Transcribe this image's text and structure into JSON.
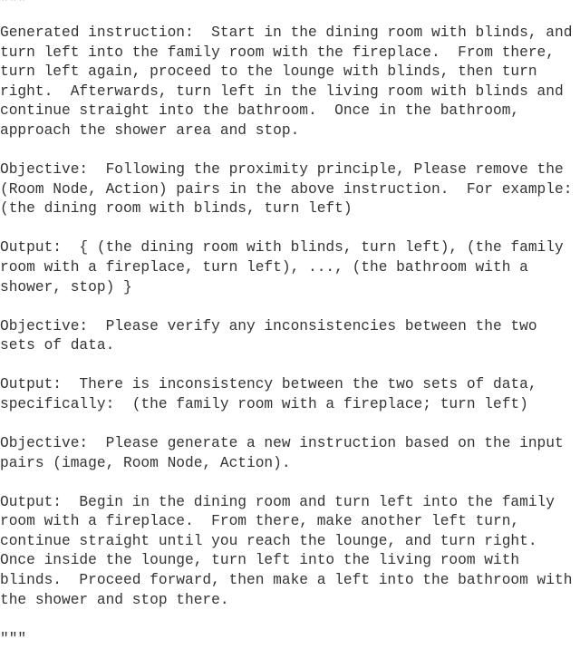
{
  "document": {
    "quote_open": "\"\"\"",
    "quote_close": "\"\"\"",
    "blocks": [
      {
        "role": "generated-instruction",
        "text": "Generated instruction:  Start in the dining room with blinds, and turn left into the family room with the fireplace.  From there, turn left again, proceed to the lounge with blinds, then turn right.  Afterwards, turn left in the living room with blinds and continue straight into the bathroom.  Once in the bathroom, approach the shower area and stop."
      },
      {
        "role": "objective-1",
        "text": "Objective:  Following the proximity principle, Please remove the (Room Node, Action) pairs in the above instruction.  For example: (the dining room with blinds, turn left)"
      },
      {
        "role": "output-1",
        "text": "Output:  { (the dining room with blinds, turn left), (the family room with a fireplace, turn left), ..., (the bathroom with a shower, stop) }"
      },
      {
        "role": "objective-2",
        "text": "Objective:  Please verify any inconsistencies between the two sets of data."
      },
      {
        "role": "output-2",
        "text": "Output:  There is inconsistency between the two sets of data, specifically:  (the family room with a fireplace; turn left)"
      },
      {
        "role": "objective-3",
        "text": "Objective:  Please generate a new instruction based on the input pairs (image, Room Node, Action)."
      },
      {
        "role": "output-3",
        "text": "Output:  Begin in the dining room and turn left into the family room with a fireplace.  From there, make another left turn, continue straight until you reach the lounge, and turn right.  Once inside the lounge, turn left into the living room with blinds.  Proceed forward, then make a left into the bathroom with the shower and stop there."
      }
    ]
  },
  "style": {
    "text_color": "#343434",
    "background_color": "#ffffff"
  }
}
